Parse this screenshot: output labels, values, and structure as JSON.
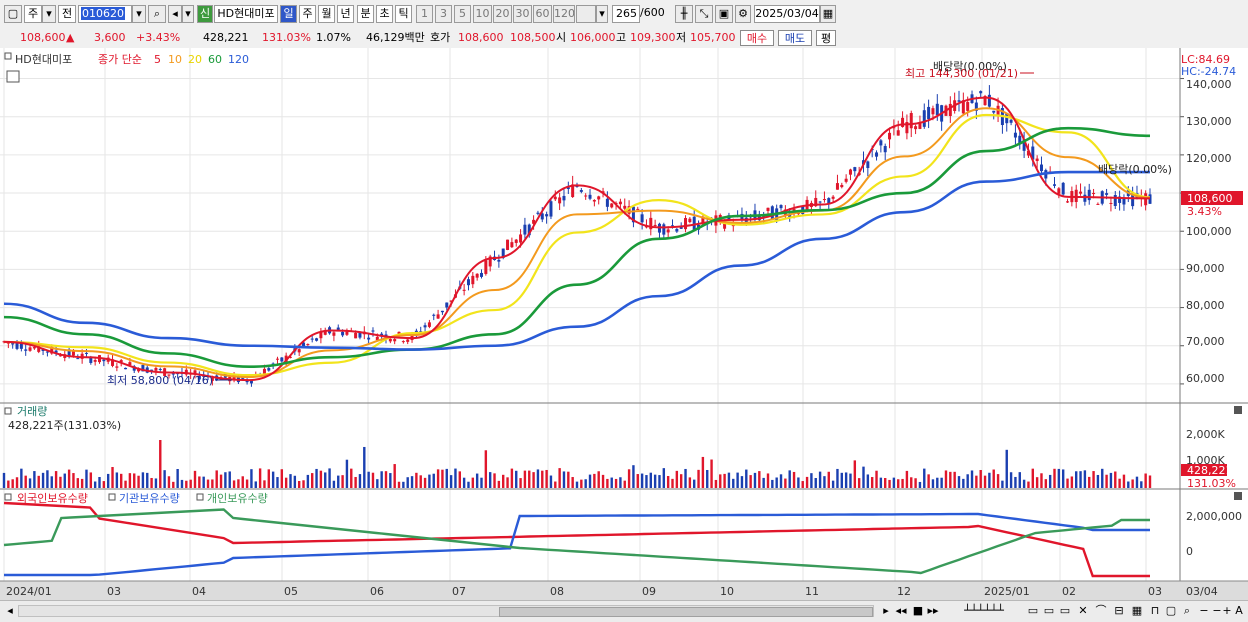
{
  "toolbar": {
    "market_label": "주",
    "prev_label": "전",
    "code": "010620",
    "new_badge": "신",
    "stock_name": "HD현대미포",
    "periods": [
      "일",
      "주",
      "월",
      "년",
      "분",
      "초",
      "틱"
    ],
    "active_period": "일",
    "minute_options": [
      "1",
      "3",
      "5",
      "10",
      "20",
      "30",
      "60",
      "120"
    ],
    "count": "265",
    "count_max": "/600",
    "date": "2025/03/04"
  },
  "quote": {
    "price": "108,600",
    "change_arrow": "▲",
    "change": "3,600",
    "change_pct": "+3.43%",
    "volume": "428,221",
    "vol_ratio": "131.03%",
    "turnover_pct": "1.07%",
    "amount": "46,129백만",
    "hoga_label": "호가",
    "ask": "108,600",
    "bid": "108,500",
    "open_label": "시",
    "open": "106,000",
    "high_label": "고",
    "high": "109,300",
    "low_label": "저",
    "low": "105,700",
    "buy_label": "매수",
    "sell_label": "매도",
    "avg_label": "평"
  },
  "price_panel": {
    "name_tag": "HD현대미포",
    "ma_label": "종가 단순",
    "ma_periods": [
      "5",
      "10",
      "20",
      "60",
      "120"
    ],
    "ma_colors": [
      "#e0162b",
      "#f39a1e",
      "#f2e41c",
      "#1a9a3a",
      "#2a5bd7"
    ],
    "lc": "LC:84.69",
    "hc": "HC:-24.74",
    "high_annot": "최고 144,300 (01/21)",
    "low_annot": "최저 58,800 (04/16)",
    "dividend_top": "배당락(0.00%)",
    "dividend_right": "배당락(0.00%)",
    "last_price": "108,600",
    "last_pct": "3.43%",
    "y_ticks": [
      "140,000",
      "130,000",
      "120,000",
      "110,000",
      "100,000",
      "90,000",
      "80,000",
      "70,000",
      "60,000"
    ]
  },
  "volume_panel": {
    "title": "거래량",
    "value": "428,221주(131.03%)",
    "y_ticks": [
      "2,000K",
      "1,000K"
    ],
    "last": "428,221",
    "last_pct": "131.03%"
  },
  "holding_panel": {
    "series": [
      {
        "name": "외국인보유수량",
        "color": "#e0162b"
      },
      {
        "name": "기관보유수량",
        "color": "#2a5bd7"
      },
      {
        "name": "개인보유수량",
        "color": "#3a9a5a"
      }
    ],
    "y_ticks": [
      "2,000,000",
      "0"
    ]
  },
  "x_axis": {
    "labels": [
      "2024/01",
      "03",
      "04",
      "05",
      "06",
      "07",
      "08",
      "09",
      "10",
      "11",
      "12",
      "2025/01",
      "02",
      "03"
    ],
    "right_label": "03/04"
  },
  "chart_data": {
    "type": "line",
    "title": "HD현대미포",
    "x": [
      "2024/01",
      "02",
      "03",
      "04",
      "05",
      "06",
      "07",
      "08",
      "09",
      "10",
      "11",
      "12",
      "2025/01",
      "02",
      "03"
    ],
    "series": [
      {
        "name": "5",
        "values": [
          71000,
          67000,
          63000,
          61000,
          74000,
          72000,
          93000,
          112000,
          101000,
          103000,
          107000,
          128000,
          135000,
          109000,
          108600
        ]
      },
      {
        "name": "60",
        "values": [
          77500,
          73000,
          68000,
          64500,
          67000,
          69000,
          73000,
          86000,
          98000,
          104000,
          105500,
          110000,
          121000,
          127000,
          125000
        ]
      },
      {
        "name": "120",
        "values": [
          81000,
          76000,
          72000,
          70000,
          69500,
          69000,
          70000,
          75000,
          83000,
          91000,
          98000,
          105000,
          113000,
          115500,
          115500
        ]
      }
    ],
    "ylim": [
      55000,
      148000
    ],
    "high": {
      "value": 144300,
      "date": "01/21"
    },
    "low": {
      "value": 58800,
      "date": "04/16"
    }
  }
}
